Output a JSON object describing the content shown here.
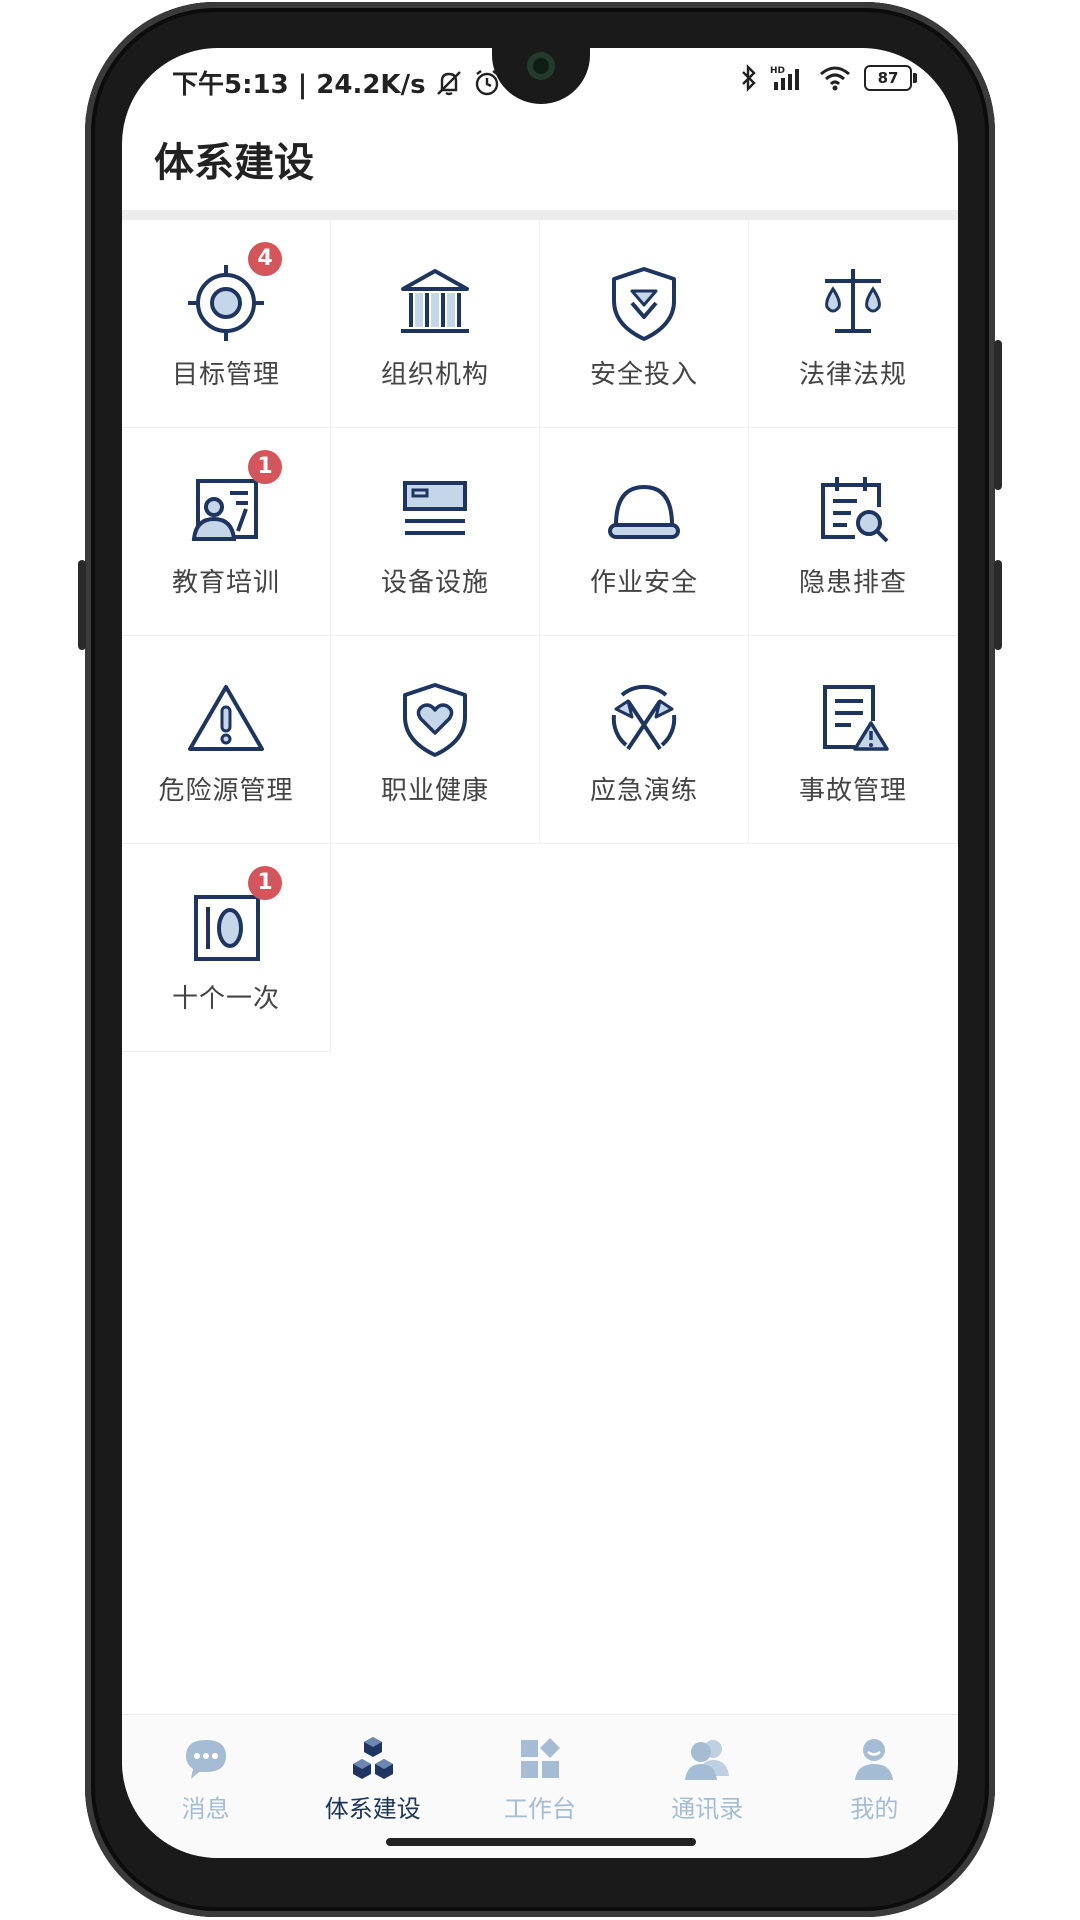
{
  "status_bar": {
    "time_speed": "下午5:13 | 24.2K/s",
    "battery": "87",
    "icons": [
      "mute-icon",
      "alarm-icon",
      "bluetooth-icon",
      "hd-signal-icon",
      "wifi-icon",
      "battery-icon"
    ]
  },
  "page": {
    "title": "体系建设"
  },
  "modules": [
    {
      "label": "目标管理",
      "icon": "target-icon",
      "badge": "4"
    },
    {
      "label": "组织机构",
      "icon": "institution-icon",
      "badge": ""
    },
    {
      "label": "安全投入",
      "icon": "shield-download-icon",
      "badge": ""
    },
    {
      "label": "法律法规",
      "icon": "scales-icon",
      "badge": ""
    },
    {
      "label": "教育培训",
      "icon": "trainer-icon",
      "badge": "1"
    },
    {
      "label": "设备设施",
      "icon": "equipment-icon",
      "badge": ""
    },
    {
      "label": "作业安全",
      "icon": "helmet-icon",
      "badge": ""
    },
    {
      "label": "隐患排查",
      "icon": "calendar-search-icon",
      "badge": ""
    },
    {
      "label": "危险源管理",
      "icon": "warning-triangle-icon",
      "badge": ""
    },
    {
      "label": "职业健康",
      "icon": "shield-heart-icon",
      "badge": ""
    },
    {
      "label": "应急演练",
      "icon": "crossed-flags-icon",
      "badge": ""
    },
    {
      "label": "事故管理",
      "icon": "document-warning-icon",
      "badge": ""
    },
    {
      "label": "十个一次",
      "icon": "frame-zero-icon",
      "badge": "1"
    }
  ],
  "tabbar": {
    "items": [
      {
        "label": "消息",
        "icon": "chat-bubble-icon"
      },
      {
        "label": "体系建设",
        "icon": "cubes-icon"
      },
      {
        "label": "工作台",
        "icon": "dashboard-icon"
      },
      {
        "label": "通讯录",
        "icon": "contacts-icon"
      },
      {
        "label": "我的",
        "icon": "profile-icon"
      }
    ],
    "active_color": "#1e3562",
    "inactive_color": "#a4bdd4"
  },
  "colors": {
    "icon_stroke": "#1e3562",
    "icon_fill": "#c5d6e8",
    "badge": "#d4555a"
  }
}
